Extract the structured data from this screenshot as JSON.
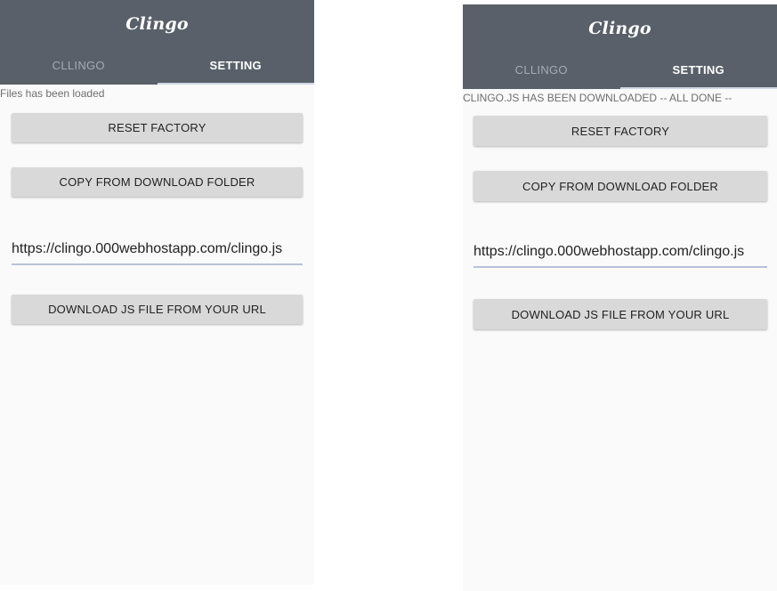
{
  "app": {
    "title": "Clingo"
  },
  "tabs": {
    "clingo": "CLLINGO",
    "setting": "SETTING"
  },
  "left": {
    "status": "Files has been loaded",
    "reset_label": "RESET FACTORY",
    "copy_label": "COPY FROM DOWNLOAD FOLDER",
    "url_value": "https://clingo.000webhostapp.com/clingo.js",
    "download_label": "DOWNLOAD JS FILE FROM YOUR URL"
  },
  "right": {
    "status": "CLINGO.JS HAS BEEN DOWNLOADED -- ALL DONE --",
    "reset_label": "RESET FACTORY",
    "copy_label": "COPY FROM DOWNLOAD FOLDER",
    "url_value": "https://clingo.000webhostapp.com/clingo.js",
    "download_label": "DOWNLOAD JS FILE FROM YOUR URL"
  },
  "colors": {
    "appbar": "#596069",
    "background": "#fafafa",
    "button": "#d9d9d9"
  }
}
